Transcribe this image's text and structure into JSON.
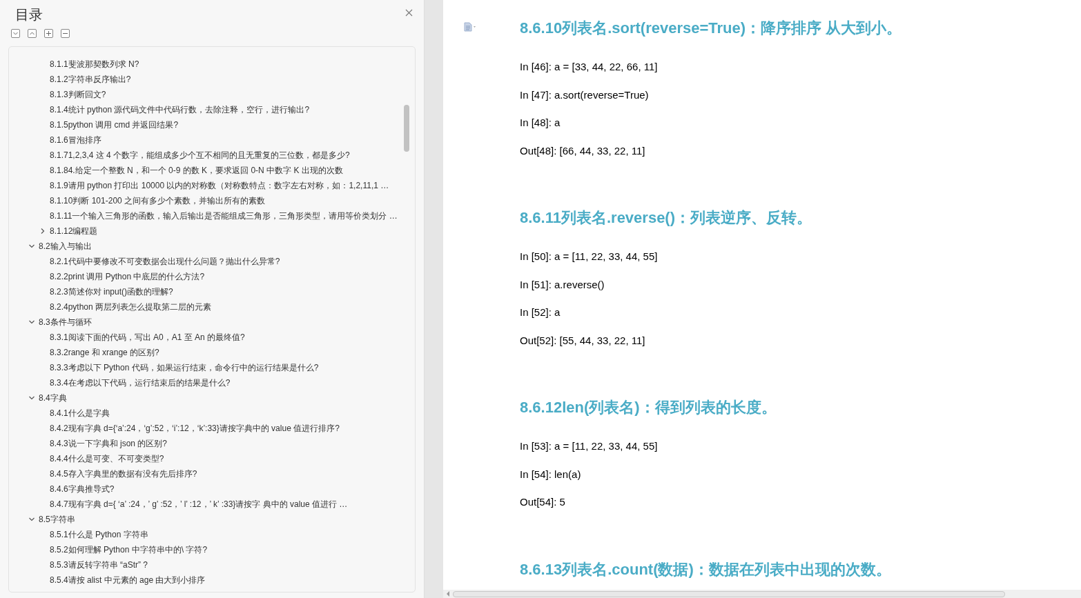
{
  "toc": {
    "title": "目录",
    "continued_items": [
      {
        "label": "8.1.1斐波那契数列求  N?"
      },
      {
        "label": "8.1.2字符串反序输出?"
      },
      {
        "label": "8.1.3判断回文?"
      },
      {
        "label": "8.1.4统计 python  源代码文件中代码行数，去除注释，空行，进行输出?"
      },
      {
        "label": "8.1.5python  调用 cmd  并返回结果?"
      },
      {
        "label": "8.1.6冒泡排序"
      },
      {
        "label": "8.1.71,2,3,4  这  4  个数字，能组成多少个互不相同的且无重复的三位数，都是多少?"
      },
      {
        "label": "8.1.84.给定一个整数  N，和一个  0-9  的数  K，要求返回  0-N  中数字  K  出现的次数"
      },
      {
        "label": "8.1.9请用  python  打印出  10000  以内的对称数（对称数特点：数字左右对称，如：1,2,11,1 …"
      },
      {
        "label": "8.1.10判断  101-200  之间有多少个素数，并输出所有的素数"
      },
      {
        "label": "8.1.11一个输入三角形的函数，输入后输出是否能组成三角形，三角形类型，请用等价类划分 …"
      },
      {
        "label": "8.1.12编程题",
        "expanded": false
      }
    ],
    "sections": [
      {
        "label": "8.2输入与输出",
        "expanded": true,
        "children": [
          {
            "label": "8.2.1代码中要修改不可变数据会出现什么问题？抛出什么异常?"
          },
          {
            "label": "8.2.2print  调用  Python  中底层的什么方法?"
          },
          {
            "label": "8.2.3简述你对  input()函数的理解?"
          },
          {
            "label": "8.2.4python  两层列表怎么提取第二层的元素"
          }
        ]
      },
      {
        "label": "8.3条件与循环",
        "expanded": true,
        "children": [
          {
            "label": "8.3.1阅读下面的代码，写出  A0，A1  至  An  的最终值?"
          },
          {
            "label": "8.3.2range  和  xrange  的区别?"
          },
          {
            "label": "8.3.3考虑以下  Python  代码，如果运行结束，命令行中的运行结果是什么?"
          },
          {
            "label": "8.3.4在考虑以下代码，运行结束后的结果是什么?"
          }
        ]
      },
      {
        "label": "8.4字典",
        "expanded": true,
        "children": [
          {
            "label": "8.4.1什么是字典"
          },
          {
            "label": "8.4.2现有字典  d={‘a’:24，‘g’:52，‘i’:12，‘k’:33}请按字典中的  value  值进行排序?"
          },
          {
            "label": "8.4.3说一下字典和  json  的区别?"
          },
          {
            "label": "8.4.4什么是可变、不可变类型?"
          },
          {
            "label": "8.4.5存入字典里的数据有没有先后排序?"
          },
          {
            "label": "8.4.6字典推导式?"
          },
          {
            "label": "8.4.7现有字典  d={  ‘a’  :24，’  g’  :52，’  l’  :12，’  k’  :33}请按字  典中的  value  值进行 …"
          }
        ]
      },
      {
        "label": "8.5字符串",
        "expanded": true,
        "children": [
          {
            "label": "8.5.1什么是 Python 字符串"
          },
          {
            "label": "8.5.2如何理解  Python  中字符串中的\\ 字符?"
          },
          {
            "label": "8.5.3请反转字符串  “aStr”  ?"
          },
          {
            "label": "8.5.4请按  alist  中元素的  age  由大到小排序"
          }
        ]
      }
    ]
  },
  "document": {
    "sections": [
      {
        "heading": "8.6.10列表名.sort(reverse=True)：降序排序  从大到小。",
        "lines": [
          "In [46]: a = [33, 44, 22, 66, 11]",
          "In [47]: a.sort(reverse=True)",
          "In [48]: a",
          "Out[48]: [66, 44, 33, 22, 11]"
        ]
      },
      {
        "heading": "8.6.11列表名.reverse()：列表逆序、反转。",
        "lines": [
          "In [50]: a = [11, 22, 33, 44, 55]",
          "In [51]: a.reverse()",
          "In [52]: a",
          "Out[52]: [55, 44, 33, 22, 11]"
        ]
      },
      {
        "heading": "8.6.12len(列表名)：得到列表的长度。",
        "lines": [
          "In [53]: a = [11, 22, 33, 44, 55]",
          "In [54]: len(a)",
          "Out[54]: 5"
        ]
      },
      {
        "heading": "8.6.13列表名.count(数据)：数据在列表中出现的次数。"
      }
    ]
  }
}
